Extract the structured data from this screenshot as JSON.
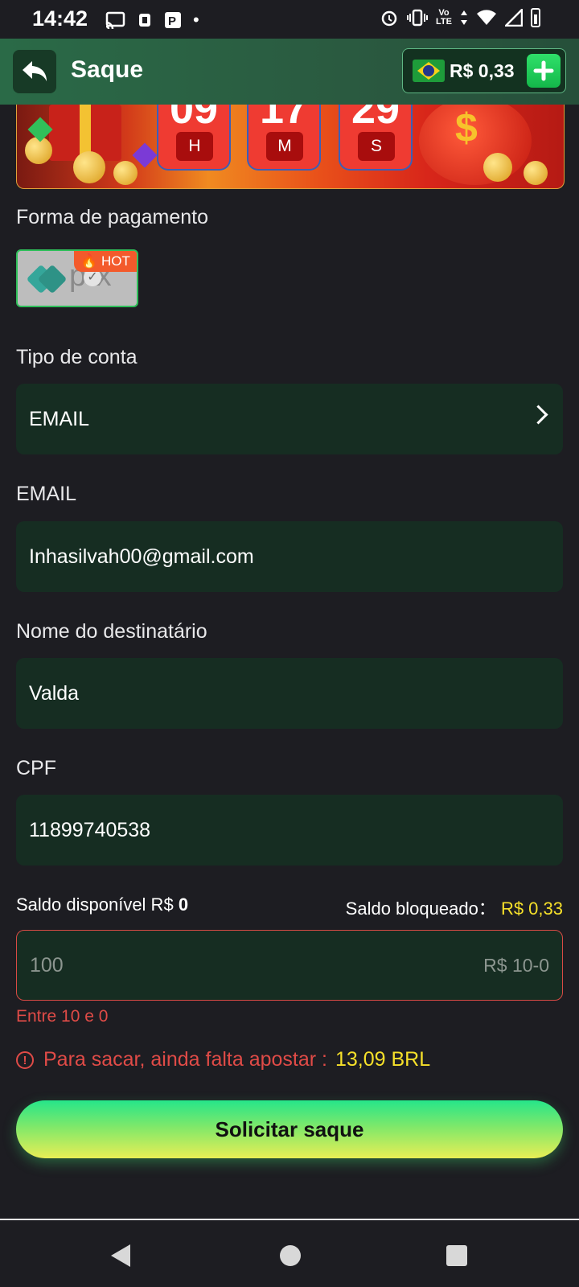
{
  "status_bar": {
    "time": "14:42",
    "volte_line1": "Vo",
    "volte_line2": "LTE"
  },
  "header": {
    "title": "Saque",
    "balance": "R$ 0,33"
  },
  "banner": {
    "timer": [
      {
        "value": "09",
        "unit": "H"
      },
      {
        "value": "17",
        "unit": "M"
      },
      {
        "value": "29",
        "unit": "S"
      }
    ]
  },
  "payment": {
    "label": "Forma de pagamento",
    "method": "pix",
    "hot_badge": "HOT"
  },
  "account_type": {
    "label": "Tipo de conta",
    "value": "EMAIL"
  },
  "email": {
    "label": "EMAIL",
    "value": "Inhasilvah00@gmail.com"
  },
  "recipient": {
    "label": "Nome do destinatário",
    "value": "Valda"
  },
  "cpf": {
    "label": "CPF",
    "value": "11899740538"
  },
  "balances": {
    "available_label": "Saldo disponível R$",
    "available_value": "0",
    "blocked_label": "Saldo bloqueado：",
    "blocked_value": "R$ 0,33"
  },
  "amount": {
    "placeholder": "100",
    "range": "R$ 10-0",
    "error": "Entre 10 e 0"
  },
  "bet_warning": {
    "icon": "!",
    "text": "Para sacar, ainda falta apostar :",
    "amount": "13,09 BRL"
  },
  "submit": {
    "label": "Solicitar saque"
  },
  "colors": {
    "background": "#1d1d22",
    "field": "#162d22",
    "accent_green": "#2fbf5a",
    "warning_red": "#e04b47",
    "highlight_yellow": "#f6e02a"
  }
}
